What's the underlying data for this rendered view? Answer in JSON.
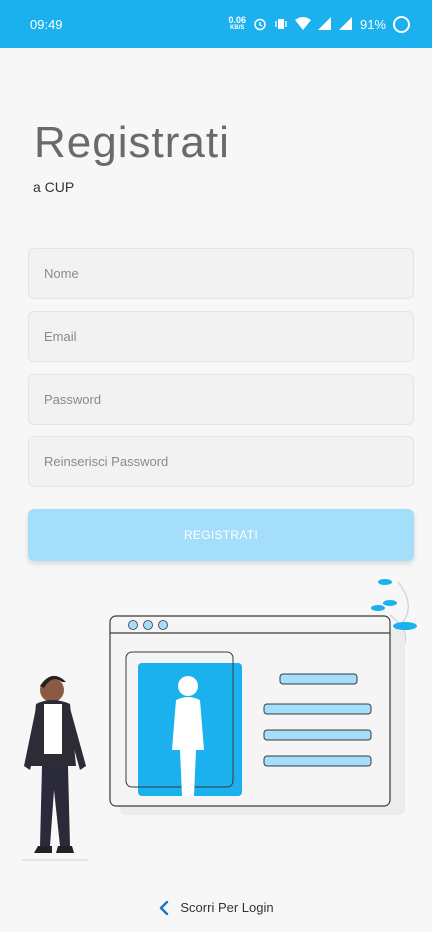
{
  "status_bar": {
    "time": "09:49",
    "net_speed_value": "0.06",
    "net_speed_unit": "KB/S",
    "battery": "91%",
    "icons": [
      "alarm-icon",
      "vibrate-icon",
      "wifi-icon",
      "signal-icon",
      "signal-icon",
      "battery-icon"
    ],
    "background": "#1ab1ee"
  },
  "header": {
    "title": "Registrati",
    "subtitle": "a CUP"
  },
  "form": {
    "name_placeholder": "Nome",
    "email_placeholder": "Email",
    "password_placeholder": "Password",
    "confirm_placeholder": "Reinserisci Password",
    "submit_label": "REGISTRATI",
    "accent": "#a5defa"
  },
  "footer": {
    "link_label": "Scorri Per Login",
    "link_icon": "chevron-left-icon",
    "link_color": "#1a73c7"
  }
}
